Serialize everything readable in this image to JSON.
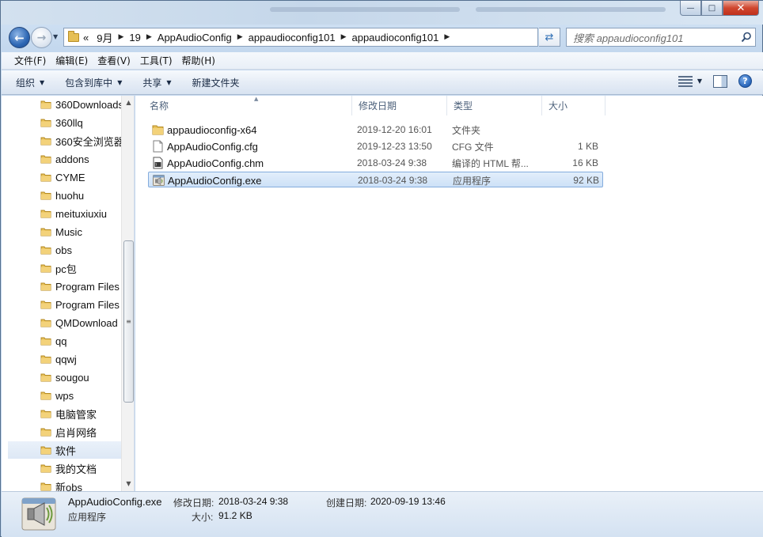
{
  "window": {
    "minimize_glyph": "—",
    "maximize_glyph": "□",
    "close_glyph": "✕"
  },
  "address": {
    "overflow": "«",
    "segments": [
      "9月",
      "19",
      "AppAudioConfig",
      "appaudioconfig101",
      "appaudioconfig101"
    ]
  },
  "search": {
    "placeholder": "搜索 appaudioconfig101"
  },
  "menubar": {
    "items": [
      "文件(F)",
      "编辑(E)",
      "查看(V)",
      "工具(T)",
      "帮助(H)"
    ]
  },
  "toolbar": {
    "organize": "组织",
    "include_in_library": "包含到库中",
    "share": "共享",
    "new_folder": "新建文件夹"
  },
  "nav": {
    "items": [
      "360Downloads",
      "360llq",
      "360安全浏览器",
      "addons",
      "CYME",
      "huohu",
      "meituxiuxiu",
      "Music",
      "obs",
      "pc包",
      "Program Files",
      "Program Files",
      "QMDownload",
      "qq",
      "qqwj",
      "sougou",
      "wps",
      "电脑管家",
      "启肖网络",
      "软件",
      "我的文档",
      "新obs"
    ],
    "selected": "软件"
  },
  "columns": {
    "name": "名称",
    "modified": "修改日期",
    "type": "类型",
    "size": "大小"
  },
  "files": [
    {
      "name": "appaudioconfig-x64",
      "modified": "2019-12-20 16:01",
      "type": "文件夹",
      "size": "",
      "icon": "folder-icon"
    },
    {
      "name": "AppAudioConfig.cfg",
      "modified": "2019-12-23 13:50",
      "type": "CFG 文件",
      "size": "1 KB",
      "icon": "document-icon"
    },
    {
      "name": "AppAudioConfig.chm",
      "modified": "2018-03-24 9:38",
      "type": "编译的 HTML 帮...",
      "size": "16 KB",
      "icon": "chm-icon"
    },
    {
      "name": "AppAudioConfig.exe",
      "modified": "2018-03-24 9:38",
      "type": "应用程序",
      "size": "92 KB",
      "icon": "speaker-app-icon",
      "selected": true
    }
  ],
  "details": {
    "name": "AppAudioConfig.exe",
    "type": "应用程序",
    "modified_label": "修改日期:",
    "modified_value": "2018-03-24 9:38",
    "size_label": "大小:",
    "size_value": "91.2 KB",
    "created_label": "创建日期:",
    "created_value": "2020-09-19 13:46"
  },
  "colors": {
    "selection": "#cde1f7",
    "selection_border": "#84acdd",
    "folder": "#e6bf55",
    "accent": "#2d67b4"
  }
}
